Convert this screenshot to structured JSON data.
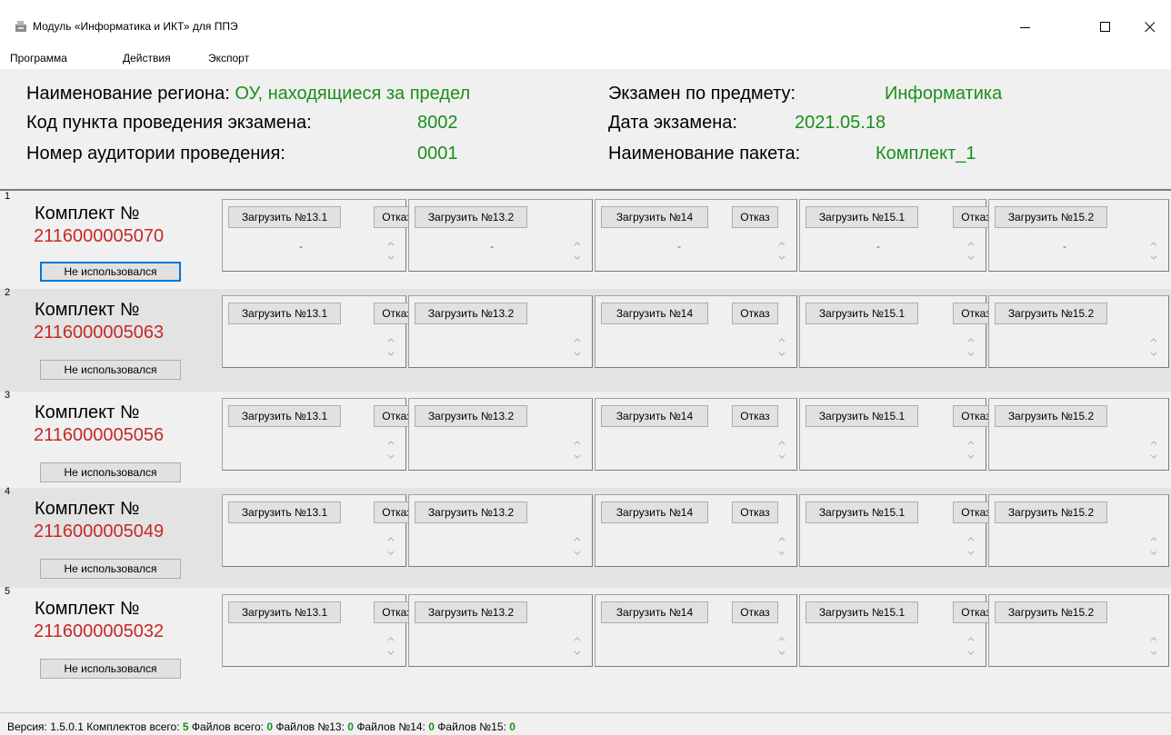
{
  "window": {
    "title": "Модуль «Информатика и ИКТ» для ППЭ"
  },
  "menu": [
    "Программа",
    "Действия",
    "Экспорт"
  ],
  "header": {
    "region_label": "Наименование региона:",
    "region_value": "ОУ, находящиеся за предел",
    "subject_label": "Экзамен по предмету:",
    "subject_value": "Информатика",
    "point_label": "Код пункта проведения экзамена:",
    "point_value": "8002",
    "date_label": "Дата экзамена:",
    "date_value": "2021.05.18",
    "room_label": "Номер аудитории проведения:",
    "room_value": "0001",
    "package_label": "Наименование пакета:",
    "package_value": "Комплект_1"
  },
  "kit_label": "Комплект №",
  "status_label": "Не использовался",
  "load_labels": [
    "Загрузить №13.1",
    "Загрузить №13.2",
    "Загрузить №14",
    "Загрузить №15.1",
    "Загрузить №15.2"
  ],
  "refuse_label": "Отказ",
  "rows": [
    {
      "index": "1",
      "kit_number": "2116000005070",
      "values": [
        "-",
        "-",
        "-",
        "-",
        "-"
      ]
    },
    {
      "index": "2",
      "kit_number": "2116000005063",
      "values": [
        "",
        "",
        "",
        "",
        ""
      ]
    },
    {
      "index": "3",
      "kit_number": "2116000005056",
      "values": [
        "",
        "",
        "",
        "",
        ""
      ]
    },
    {
      "index": "4",
      "kit_number": "2116000005049",
      "values": [
        "",
        "",
        "",
        "",
        ""
      ]
    },
    {
      "index": "5",
      "kit_number": "2116000005032",
      "values": [
        "",
        "",
        "",
        "",
        ""
      ]
    }
  ],
  "statusbar": {
    "version_label": "Версия:",
    "version_value": "1.5.0.1",
    "kits_label": "Комплектов всего:",
    "kits_value": "5",
    "files_label": "Файлов всего:",
    "files_value": "0",
    "files13_label": "Файлов №13:",
    "files13_value": "0",
    "files14_label": "Файлов №14:",
    "files14_value": "0",
    "files15_label": "Файлов №15:",
    "files15_value": "0"
  }
}
